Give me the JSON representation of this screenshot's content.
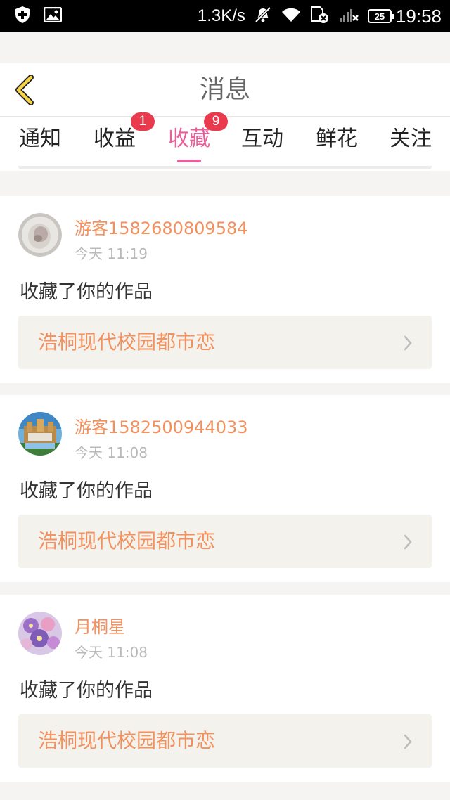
{
  "status_bar": {
    "speed": "1.3K/s",
    "battery": "25",
    "time": "19:58"
  },
  "header": {
    "title": "消息"
  },
  "tabs": [
    {
      "label": "通知",
      "badge": ""
    },
    {
      "label": "收益",
      "badge": "1"
    },
    {
      "label": "收藏",
      "badge": "9",
      "active": true
    },
    {
      "label": "互动",
      "badge": ""
    },
    {
      "label": "鲜花",
      "badge": ""
    },
    {
      "label": "关注",
      "badge": ""
    }
  ],
  "messages": [
    {
      "user": "游客1582680809584",
      "time": "今天 11:19",
      "action": "收藏了你的作品",
      "work": "浩桐现代校园都市恋"
    },
    {
      "user": "游客1582500944033",
      "time": "今天 11:08",
      "action": "收藏了你的作品",
      "work": "浩桐现代校园都市恋"
    },
    {
      "user": "月桐星",
      "time": "今天 11:08",
      "action": "收藏了你的作品",
      "work": "浩桐现代校园都市恋"
    }
  ],
  "colors": {
    "accent_pink": "#e85f9a",
    "name_orange": "#f2905e",
    "badge_red": "#ea3a4e"
  }
}
